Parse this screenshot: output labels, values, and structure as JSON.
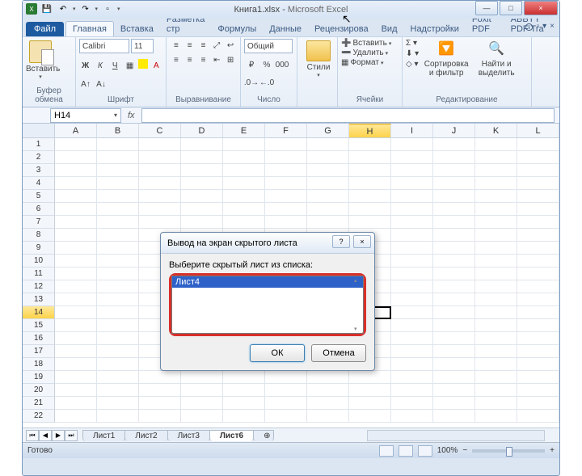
{
  "window": {
    "doc_title": "Книга1.xlsx",
    "app_title": "Microsoft Excel",
    "min": "—",
    "max": "□",
    "close": "×"
  },
  "qat": {
    "save": "💾",
    "undo": "↶",
    "redo": "↷",
    "new": "▫"
  },
  "tabs": {
    "file": "Файл",
    "home": "Главная",
    "insert": "Вставка",
    "layout": "Разметка стр",
    "formulas": "Формулы",
    "data": "Данные",
    "review": "Рецензирова",
    "view": "Вид",
    "addins": "Надстройки",
    "foxit": "Foxit PDF",
    "abbyy": "ABBYY PDF Tra"
  },
  "ribbon": {
    "clipboard": {
      "paste": "Вставить",
      "label": "Буфер обмена"
    },
    "font": {
      "name": "Calibri",
      "size": "11",
      "bold": "Ж",
      "italic": "К",
      "underline": "Ч",
      "label": "Шрифт"
    },
    "align": {
      "label": "Выравнивание"
    },
    "number": {
      "format": "Общий",
      "label": "Число",
      "pct": "%",
      "comma": "000"
    },
    "styles": {
      "btn": "Стили"
    },
    "cells": {
      "insert": "Вставить",
      "delete": "Удалить",
      "format": "Формат",
      "label": "Ячейки"
    },
    "editing": {
      "sum": "Σ",
      "sort": "Сортировка и фильтр",
      "find": "Найти и выделить",
      "label": "Редактирование"
    }
  },
  "namebox": "H14",
  "fx": "fx",
  "columns": [
    "A",
    "B",
    "C",
    "D",
    "E",
    "F",
    "G",
    "H",
    "I",
    "J",
    "K",
    "L"
  ],
  "rows": [
    "1",
    "2",
    "3",
    "4",
    "5",
    "6",
    "7",
    "8",
    "9",
    "10",
    "11",
    "12",
    "13",
    "14",
    "15",
    "16",
    "17",
    "18",
    "19",
    "20",
    "21",
    "22"
  ],
  "selected_col": "H",
  "selected_row": "14",
  "sheets": {
    "nav": [
      "⏮",
      "◀",
      "▶",
      "⏭"
    ],
    "tabs": [
      "Лист1",
      "Лист2",
      "Лист3",
      "Лист6"
    ],
    "active": "Лист6",
    "new": "⊕"
  },
  "status": {
    "ready": "Готово",
    "zoom": "100%",
    "minus": "−",
    "plus": "+"
  },
  "dialog": {
    "title": "Вывод на экран скрытого листа",
    "help": "?",
    "close": "×",
    "prompt": "Выберите скрытый лист из списка:",
    "items": [
      "Лист4"
    ],
    "ok": "ОК",
    "cancel": "Отмена"
  }
}
